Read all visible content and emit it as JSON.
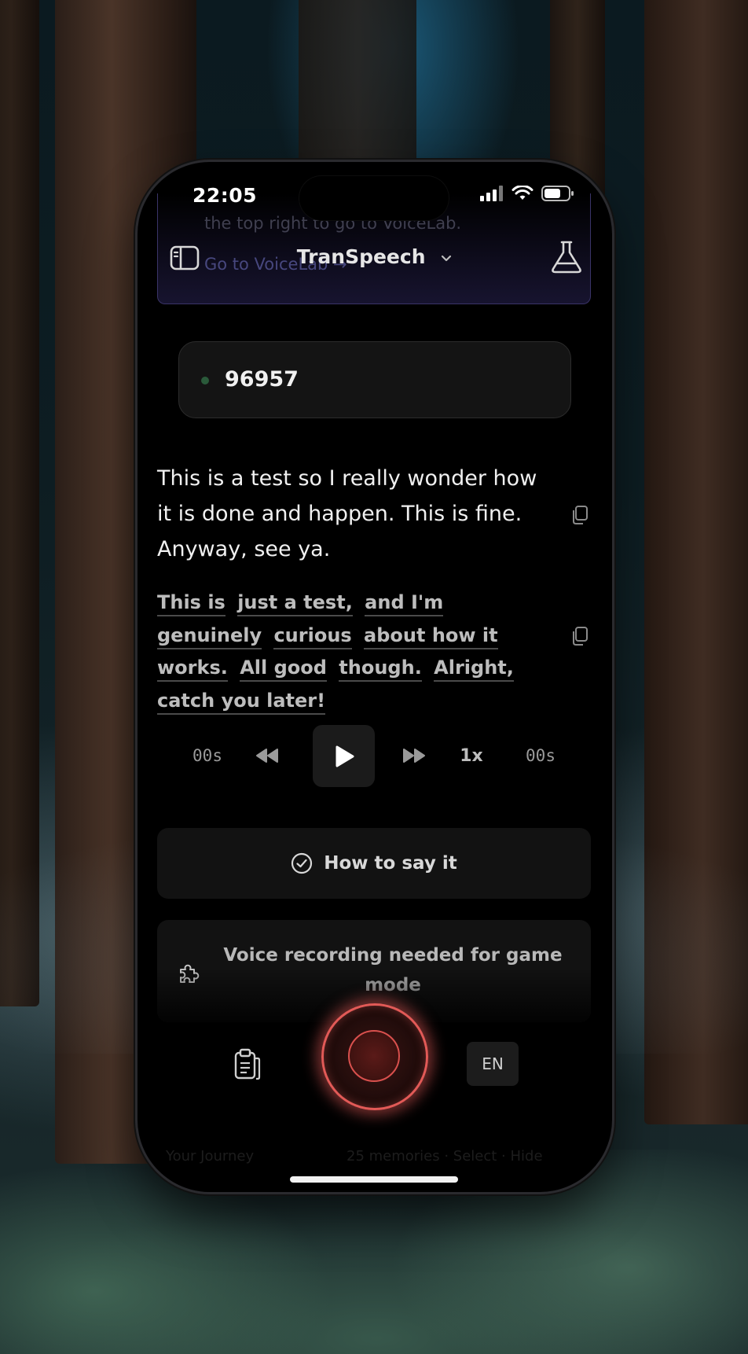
{
  "status_bar": {
    "time": "22:05"
  },
  "banner": {
    "text": "the top right to go to VoiceLab.",
    "link_label": "Go to VoiceLab",
    "link_arrow": "→"
  },
  "nav": {
    "title": "TranSpeech",
    "left_icon": "sidebar-toggle-icon",
    "right_icon": "flask-icon"
  },
  "session": {
    "id": "96957",
    "status_color": "#2a5a3a"
  },
  "transcript": {
    "original": "This is a test so I really wonder how it is done and happen. This is fine. Anyway, see ya.",
    "translated_chunks": [
      "This is",
      "just a test,",
      "and I'm",
      "genuinely",
      "curious",
      "about how it works.",
      "All good",
      "though.",
      "Alright,",
      "catch you later!"
    ]
  },
  "player": {
    "elapsed": "00s",
    "speed": "1x",
    "duration": "00s"
  },
  "actions": {
    "how_to_say": "How to say it",
    "game_mode": "Voice recording needed for game mode"
  },
  "bottom_bar": {
    "language": "EN",
    "record_color": "#e25a57"
  },
  "footer_ghost": {
    "left": "Your Journey",
    "right": "25 memories · Select · Hide"
  }
}
